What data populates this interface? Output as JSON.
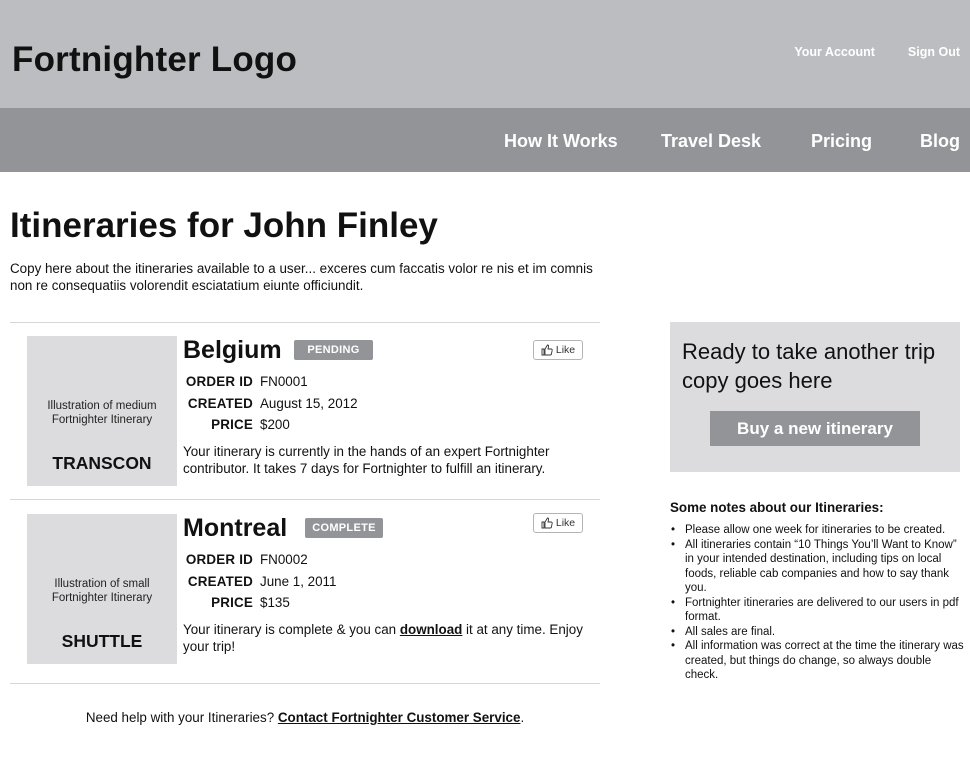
{
  "header": {
    "logo": "Fortnighter Logo",
    "account_links": [
      "Your Account",
      "Sign Out"
    ]
  },
  "nav": {
    "items": [
      "How It Works",
      "Travel Desk",
      "Pricing",
      "Blog"
    ]
  },
  "main": {
    "title": "Itineraries for John Finley",
    "intro": "Copy here about the itineraries available to a user... exceres cum faccatis volor re nis et im comnis non re consequatiis volorendit esciatatium eiunte officiundit.",
    "labels": {
      "order_id": "ORDER ID",
      "created": "CREATED",
      "price": "PRICE",
      "like": "Like"
    },
    "itineraries": [
      {
        "destination": "Belgium",
        "status": "PENDING",
        "order_id": "FN0001",
        "created": "August 15, 2012",
        "price": "$200",
        "thumb_caption": "Illustration of medium Fortnighter Itinerary",
        "thumb_type": "TRANSCON",
        "description": "Your itinerary is currently in the hands of an expert Fortnighter contributor. It takes 7 days for Fortnighter to fulfill an itinerary."
      },
      {
        "destination": "Montreal",
        "status": "COMPLETE",
        "order_id": "FN0002",
        "created": "June 1, 2011",
        "price": "$135",
        "thumb_caption": "Illustration of small Fortnighter Itinerary",
        "thumb_type": "SHUTTLE",
        "description_before": "Your itinerary is complete & you can ",
        "description_link": "download",
        "description_after": " it at any time. Enjoy your trip!"
      }
    ],
    "help": {
      "prefix": "Need help with your Itineraries? ",
      "link": "Contact Fortnighter Customer Service",
      "suffix": "."
    }
  },
  "sidebar": {
    "promo_text": "Ready to take another trip copy goes here",
    "buy_button": "Buy a new itinerary",
    "notes_title": "Some notes about our Itineraries:",
    "notes": [
      "Please allow one week for itineraries to be created.",
      "All itineraries contain “10 Things You’ll Want to Know” in your intended destination, including tips on local foods, reliable cab companies and how to say thank you.",
      "Fortnighter itineraries are delivered to our users in pdf format.",
      "All sales are final.",
      "All information was correct at the time the itinerary was created, but things do change, so always double check."
    ]
  },
  "colors": {
    "topbar": "#bcbdc1",
    "navbar": "#939498",
    "panel": "#dcdcde",
    "badge": "#939498"
  }
}
